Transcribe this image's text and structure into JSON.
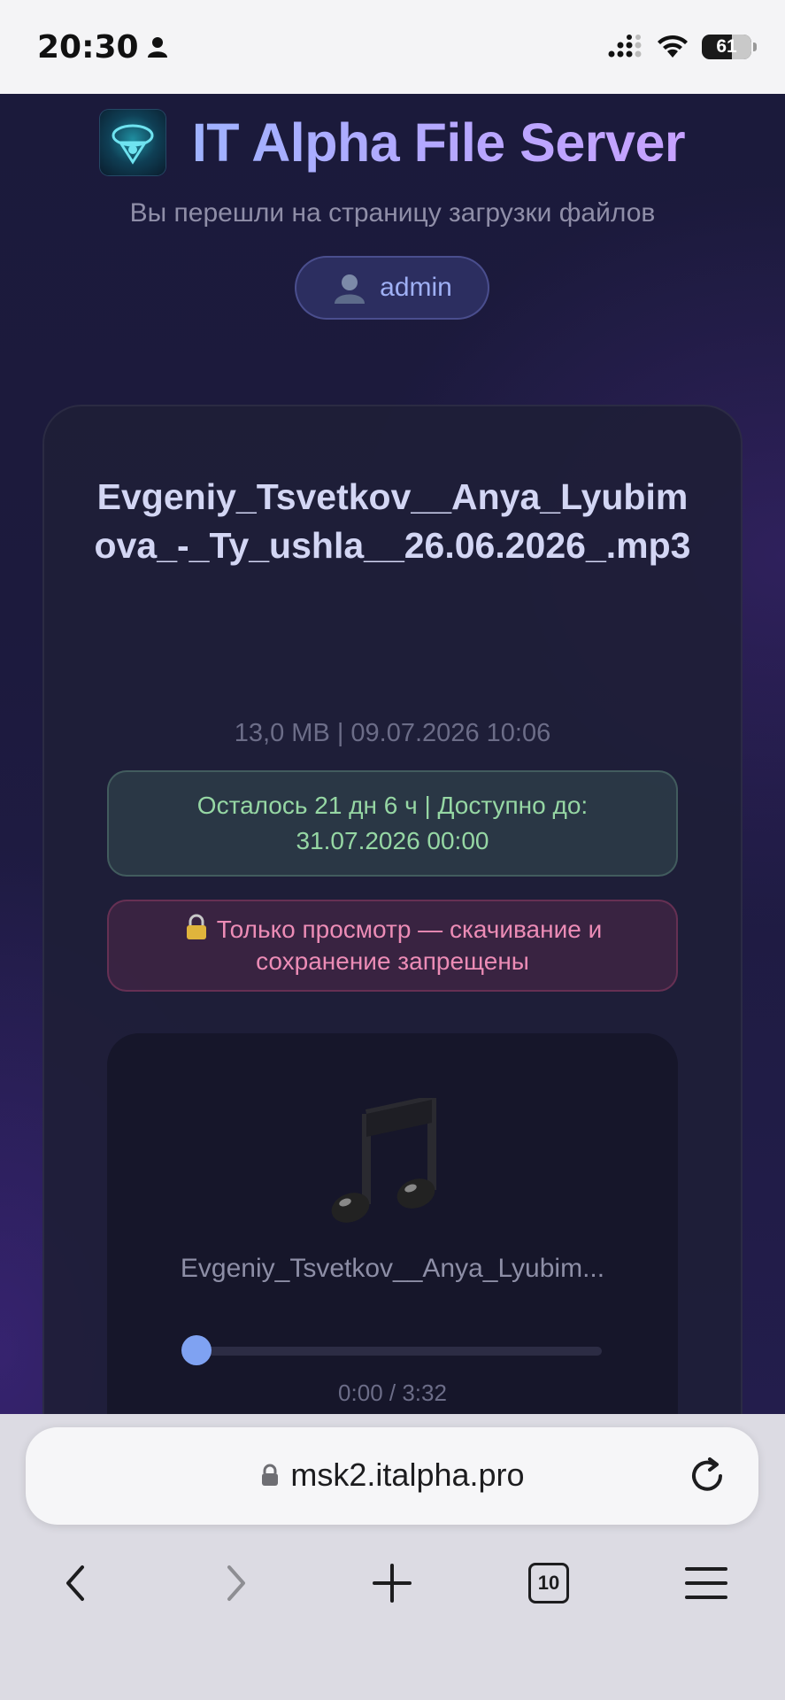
{
  "status_bar": {
    "time": "20:30",
    "battery": "61"
  },
  "header": {
    "title": "IT Alpha File Server",
    "subtitle": "Вы перешли на страницу загрузки файлов",
    "user": "admin"
  },
  "file": {
    "name": "Evgeniy_Tsvetkov__Anya_Lyubimova_-_Ty_ushla__26.06.2026_.mp3",
    "meta": "13,0 MB | 09.07.2026 10:06",
    "expiry": "Осталось 21 дн 6 ч | Доступно до: 31.07.2026 00:00",
    "restriction": "Только просмотр — скачивание и сохранение запрещены"
  },
  "player": {
    "track_title": "Evgeniy_Tsvetkov__Anya_Lyubim...",
    "time": "0:00 / 3:32",
    "progress": 0
  },
  "browser": {
    "url": "msk2.italpha.pro",
    "tab_count": "10"
  },
  "colors": {
    "accent": "#7fa2f2",
    "success_text": "#96d7a4",
    "warning_text": "#ec8cb6"
  }
}
